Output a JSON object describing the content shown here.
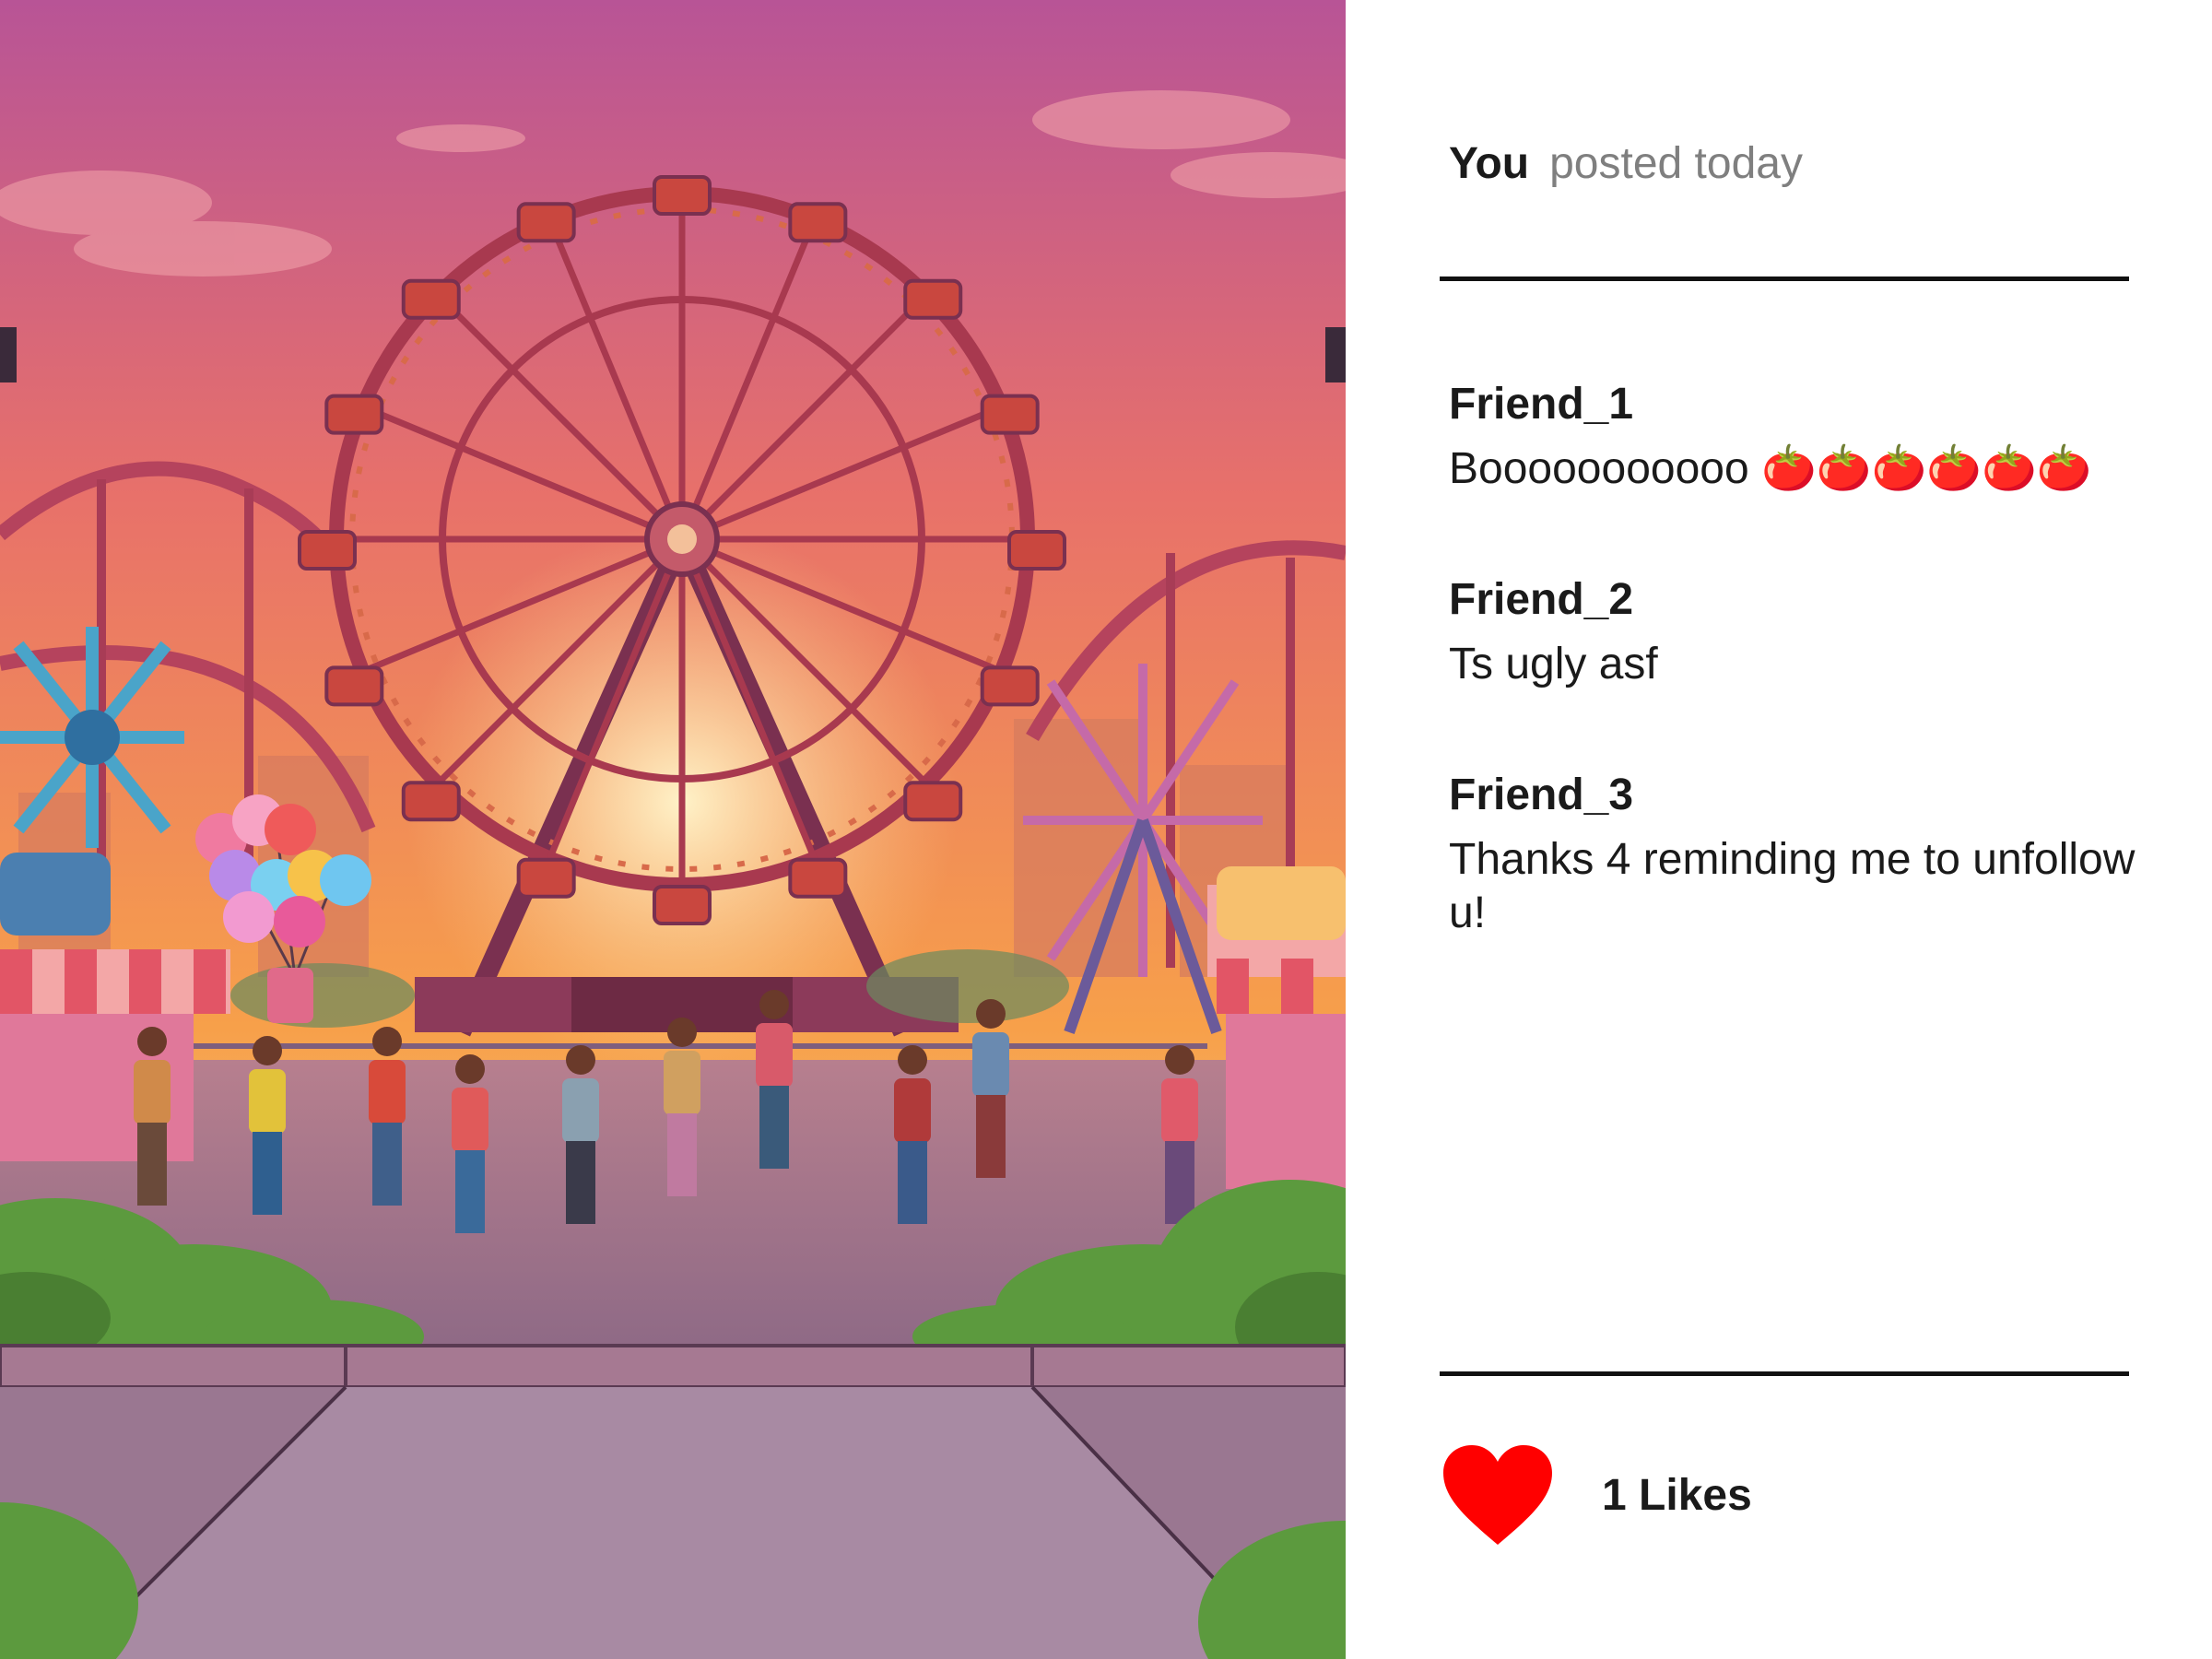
{
  "post": {
    "author": "You",
    "posted_label": "posted today"
  },
  "comments": [
    {
      "name": "Friend_1",
      "text": "Booooooooooo 🍅🍅🍅🍅🍅🍅"
    },
    {
      "name": "Friend_2",
      "text": "Ts ugly asf"
    },
    {
      "name": "Friend_3",
      "text": "Thanks 4 reminding me to unfollow u!"
    }
  ],
  "likes": {
    "label": "1 Likes",
    "icon": "heart-icon",
    "color": "#ff0000"
  },
  "image": {
    "subject": "amusement-park-ferris-wheel-illustration"
  },
  "colors": {
    "sky_top": "#b85496",
    "sky_bottom": "#f7a04a",
    "text": "#1a1a1a",
    "muted": "#7f7f7f"
  }
}
